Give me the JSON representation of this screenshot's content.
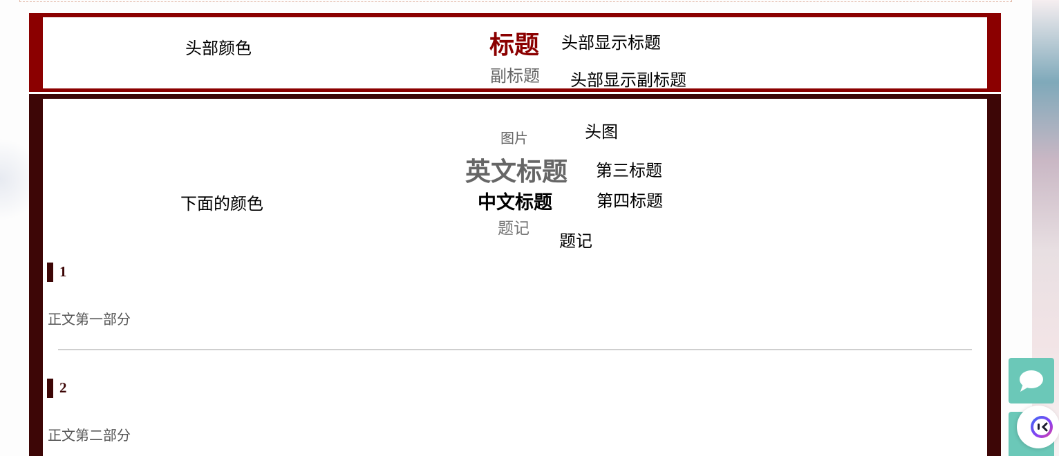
{
  "header": {
    "color_label": "头部颜色",
    "title": "标题",
    "title_label": "头部显示标题",
    "subtitle": "副标题",
    "subtitle_label": "头部显示副标题"
  },
  "body": {
    "color_label": "下面的颜色",
    "image_alt": "图片",
    "image_label": "头图",
    "english_title": "英文标题",
    "third_title_label": "第三标题",
    "chinese_title": "中文标题",
    "fourth_title_label": "第四标题",
    "note": "题记",
    "note_label": "题记"
  },
  "sections": [
    {
      "number": "1",
      "text": "正文第一部分"
    },
    {
      "number": "2",
      "text": "正文第二部分"
    }
  ],
  "icons": {
    "chat": "chat-bubble-icon",
    "back_to_top": "arrow-up-icon",
    "assistant": "robot-face-icon"
  },
  "colors": {
    "header_frame": "#8b0000",
    "body_frame": "#3d0606",
    "float_button": "#6bc8b8"
  }
}
